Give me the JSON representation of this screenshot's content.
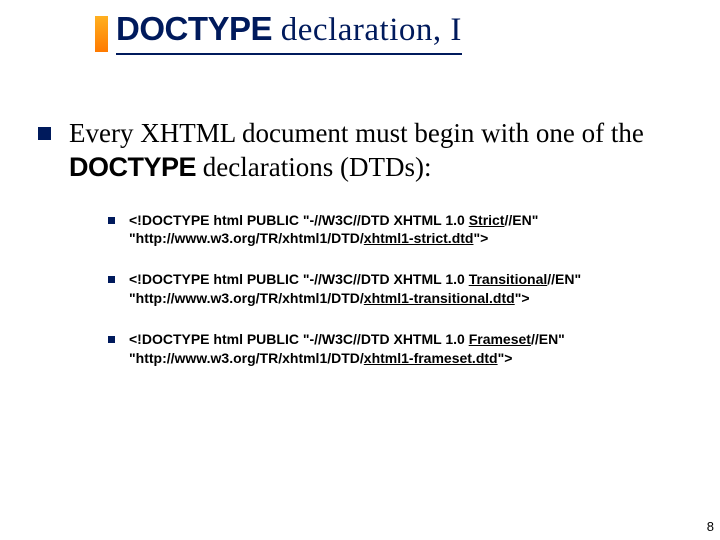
{
  "title": {
    "bold": "DOCTYPE",
    "rest": " declaration, I"
  },
  "main": {
    "pre": "Every XHTML document must begin with one of the ",
    "mono": "DOCTYPE",
    "post": " declarations (DTDs):"
  },
  "items": [
    {
      "a": "<!DOCTYPE html PUBLIC \"-//W3C//DTD XHTML 1.0 ",
      "u1": "Strict",
      "b": "//EN\" \"http://www.w3.org/TR/xhtml1/DTD/",
      "u2": "xhtml1-strict.dtd",
      "c": "\">"
    },
    {
      "a": "<!DOCTYPE html PUBLIC \"-//W3C//DTD XHTML 1.0 ",
      "u1": "Transitional",
      "b": "//EN\" \"http://www.w3.org/TR/xhtml1/DTD/",
      "u2": "xhtml1-transitional.dtd",
      "c": "\">"
    },
    {
      "a": "<!DOCTYPE html PUBLIC \"-//W3C//DTD XHTML 1.0 ",
      "u1": "Frameset",
      "b": "//EN\" \"http://www.w3.org/TR/xhtml1/DTD/",
      "u2": "xhtml1-frameset.dtd",
      "c": "\">"
    }
  ],
  "page": "8"
}
